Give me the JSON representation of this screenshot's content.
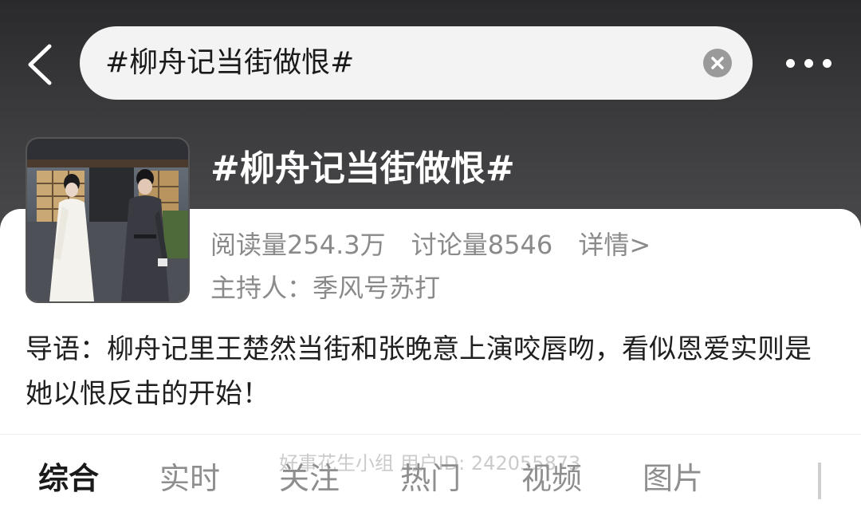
{
  "header": {
    "search_query": "#柳舟记当街做恨#"
  },
  "topic": {
    "title": "#柳舟记当街做恨#",
    "reads": "阅读量254.3万",
    "discussions": "讨论量8546",
    "details_link": "详情>",
    "host": "主持人：季风号苏打",
    "lead": "导语：柳舟记里王楚然当街和张晚意上演咬唇吻，看似恩爱实则是她以恨反击的开始！"
  },
  "tabs": [
    {
      "label": "综合"
    },
    {
      "label": "实时"
    },
    {
      "label": "关注"
    },
    {
      "label": "热门"
    },
    {
      "label": "视频"
    },
    {
      "label": "图片"
    }
  ],
  "watermark": "好事花生小组   用户ID: 242055873",
  "colors": {
    "header_bg": "#333335",
    "search_bg": "#f3f3f3",
    "muted_text": "#8a8a8a",
    "active_tab": "#1a1a1a"
  },
  "icons": {
    "back": "chevron-left-icon",
    "clear": "clear-circle-icon",
    "more": "more-dots-icon"
  }
}
